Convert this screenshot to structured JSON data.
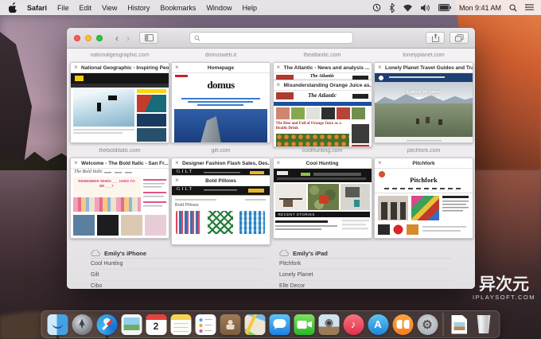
{
  "menu_bar": {
    "app_name": "Safari",
    "menus": [
      "File",
      "Edit",
      "View",
      "History",
      "Bookmarks",
      "Window",
      "Help"
    ],
    "status": {
      "clock": "Mon 9:41 AM"
    }
  },
  "toolbar": {
    "search_value": ""
  },
  "overview": {
    "close_glyph": "×",
    "groups": [
      {
        "domain": "nationalgeographic.com",
        "tabs": [
          {
            "title": "National Geographic - Inspiring Peo..."
          }
        ]
      },
      {
        "domain": "domusweb.it",
        "tabs": [
          {
            "title": "Homepage",
            "page": {
              "logo": "domus"
            }
          }
        ]
      },
      {
        "domain": "theatlantic.com",
        "tabs": [
          {
            "title": "The Atlantic - News and analysis ...",
            "page": {
              "logo": "The Atlantic"
            }
          },
          {
            "title": "Misunderstanding Orange Juice as...",
            "page": {
              "logo": "The Atlantic",
              "headline": "The Rise and Fall of Orange Juice as a Health Drink"
            }
          }
        ]
      },
      {
        "domain": "lonelyplanet.com",
        "tabs": [
          {
            "title": "Lonely Planet Travel Guides and Tra...",
            "page": {
              "hero": "Explore the planet"
            }
          }
        ]
      },
      {
        "domain": "thebolditalic.com",
        "tabs": [
          {
            "title": "Welcome - The Bold Italic - San Fr...",
            "page": {
              "logo": "The Bold Italic",
              "hero": "REMEMBER WHEN ___ USED TO BE ___?"
            }
          }
        ]
      },
      {
        "domain": "gilt.com",
        "tabs": [
          {
            "title": "Designer Fashion Flash Sales, Des...",
            "page": {
              "logo": "GILT"
            }
          },
          {
            "title": "Bold Pillows",
            "page": {
              "logo": "GILT",
              "heading": "Bold Pillows"
            }
          }
        ]
      },
      {
        "domain": "coolhunting.com",
        "tabs": [
          {
            "title": "Cool Hunting",
            "page": {
              "bar": "RECENT STORIES"
            }
          }
        ]
      },
      {
        "domain": "pitchfork.com",
        "tabs": [
          {
            "title": "Pitchfork",
            "page": {
              "logo": "Pitchfork"
            }
          }
        ]
      }
    ],
    "icloud": [
      {
        "device": "Emily's iPhone",
        "tabs": [
          "Cool Hunting",
          "Gilt",
          "Cibo"
        ]
      },
      {
        "device": "Emily's iPad",
        "tabs": [
          "Pitchfork",
          "Lonely Planet",
          "Elle Decor"
        ]
      }
    ]
  },
  "dock": {
    "items": [
      "finder",
      "launchpad",
      "safari",
      "photos",
      "calendar",
      "notes",
      "reminders",
      "contacts",
      "maps",
      "messages",
      "facetime",
      "iphoto",
      "itunes",
      "app-store",
      "ibooks",
      "system-preferences",
      "downloads",
      "trash"
    ],
    "calendar_day": "2",
    "glyphs": {
      "itunes": "♪",
      "app_store": "A",
      "system_preferences": "⚙"
    }
  },
  "watermark": {
    "title": "异次元",
    "url": "IPLAYSOFT.COM"
  },
  "colors": {
    "traffic_close": "#fc5b57",
    "traffic_min": "#fdbc2e",
    "traffic_zoom": "#28c83d",
    "accent_blue": "#1d7fe0"
  }
}
